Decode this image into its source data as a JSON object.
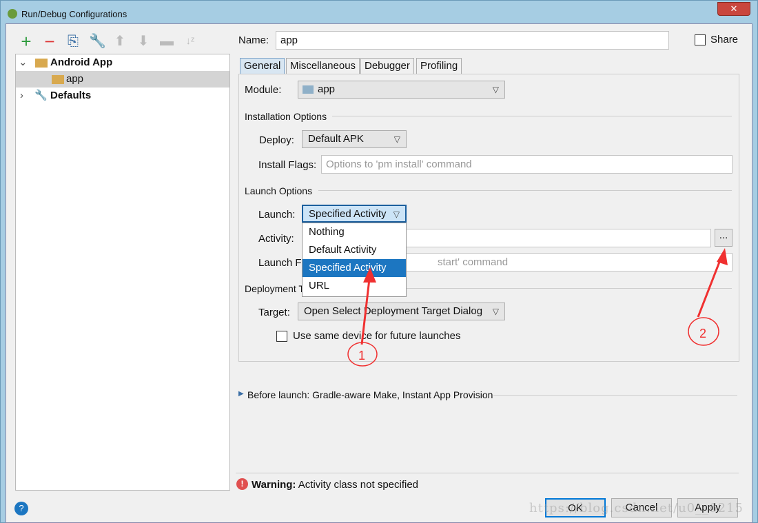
{
  "window": {
    "title": "Run/Debug Configurations",
    "close_label": "✕"
  },
  "toolbar": {
    "icons": [
      "add-icon",
      "remove-icon",
      "copy-icon",
      "edit-defaults-icon",
      "move-up-icon",
      "move-down-icon",
      "folder-icon",
      "sort-icon"
    ]
  },
  "tree": [
    {
      "label": "Android App",
      "expanded": true
    },
    {
      "label": "app",
      "selected": true
    },
    {
      "label": "Defaults",
      "expanded": false
    }
  ],
  "form": {
    "name_label": "Name:",
    "name_value": "app",
    "share_label": "Share",
    "share_checked": false,
    "tabs": [
      "General",
      "Miscellaneous",
      "Debugger",
      "Profiling"
    ],
    "active_tab": "General",
    "module_label": "Module:",
    "module_value": "app",
    "installation_section": "Installation Options",
    "deploy_label": "Deploy:",
    "deploy_value": "Default APK",
    "install_flags_label": "Install Flags:",
    "install_flags_placeholder": "Options to 'pm install' command",
    "launch_section": "Launch Options",
    "launch_label": "Launch:",
    "launch_value": "Specified Activity",
    "launch_options": [
      "Nothing",
      "Default Activity",
      "Specified Activity",
      "URL"
    ],
    "activity_label": "Activity:",
    "activity_value": "",
    "browse_label": "...",
    "launch_flags_label": "Launch Fl",
    "launch_flags_placeholder": "start' command",
    "deployment_section": "Deployment T",
    "target_label": "Target:",
    "target_value": "Open Select Deployment Target Dialog",
    "same_device_label": "Use same device for future launches",
    "same_device_checked": false,
    "before_launch": "Before launch: Gradle-aware Make, Instant App Provision"
  },
  "warning": {
    "bold": "Warning:",
    "text": "Activity class not specified"
  },
  "buttons": {
    "ok": "OK",
    "cancel": "Cancel",
    "apply": "Apply",
    "help": "?"
  },
  "annotations": [
    "1",
    "2"
  ],
  "annotation_color": "#f03030",
  "watermark": "https://blog.csdn.net/u0__6215"
}
